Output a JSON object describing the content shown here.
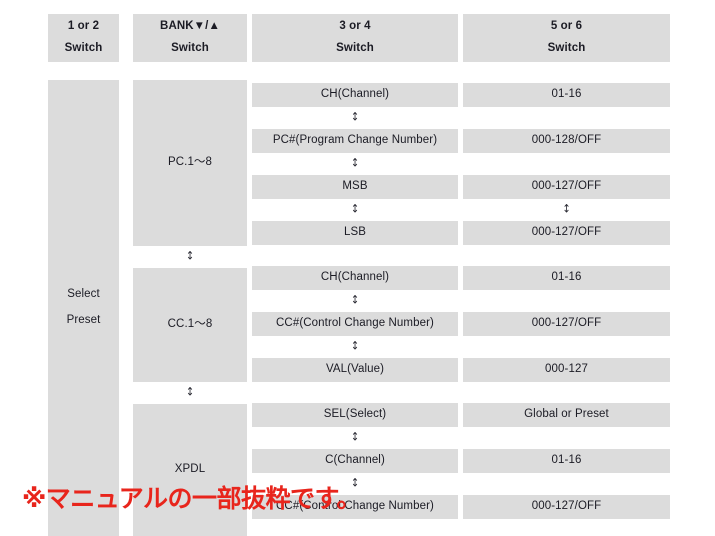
{
  "headers": [
    {
      "line1": "1 or 2",
      "line2": "Switch"
    },
    {
      "line1": "BANK▼/▲",
      "line2": "Switch"
    },
    {
      "line1": "3 or 4",
      "line2": "Switch"
    },
    {
      "line1": "5 or 6",
      "line2": "Switch"
    }
  ],
  "select_preset": {
    "line1": "Select",
    "line2": "Preset"
  },
  "modes": [
    {
      "label": "PC.1～8"
    },
    {
      "label": "CC.1～8"
    },
    {
      "label": "XPDL"
    }
  ],
  "pc_params": [
    {
      "name": "CH(Channel)",
      "value": "01-16"
    },
    {
      "name": "PC#(Program Change Number)",
      "value": "000-128/OFF"
    },
    {
      "name": "MSB",
      "value": "000-127/OFF"
    },
    {
      "name": "LSB",
      "value": "000-127/OFF"
    }
  ],
  "cc_params": [
    {
      "name": "CH(Channel)",
      "value": "01-16"
    },
    {
      "name": "CC#(Control Change Number)",
      "value": "000-127/OFF"
    },
    {
      "name": "VAL(Value)",
      "value": "000-127"
    }
  ],
  "xpdl_params": [
    {
      "name": "SEL(Select)",
      "value": "Global or Preset"
    },
    {
      "name": "C(Channel)",
      "value": "01-16"
    },
    {
      "name": "CC#(Control Change Number)",
      "value": "000-127/OFF"
    }
  ],
  "connector_glyph": "↕",
  "note": "※マニュアルの一部抜粋です。",
  "colors": {
    "cell_bg": "#dcdcdc",
    "page_bg": "#ffffff",
    "text": "#1b1b24",
    "note_red": "#e8251c"
  }
}
